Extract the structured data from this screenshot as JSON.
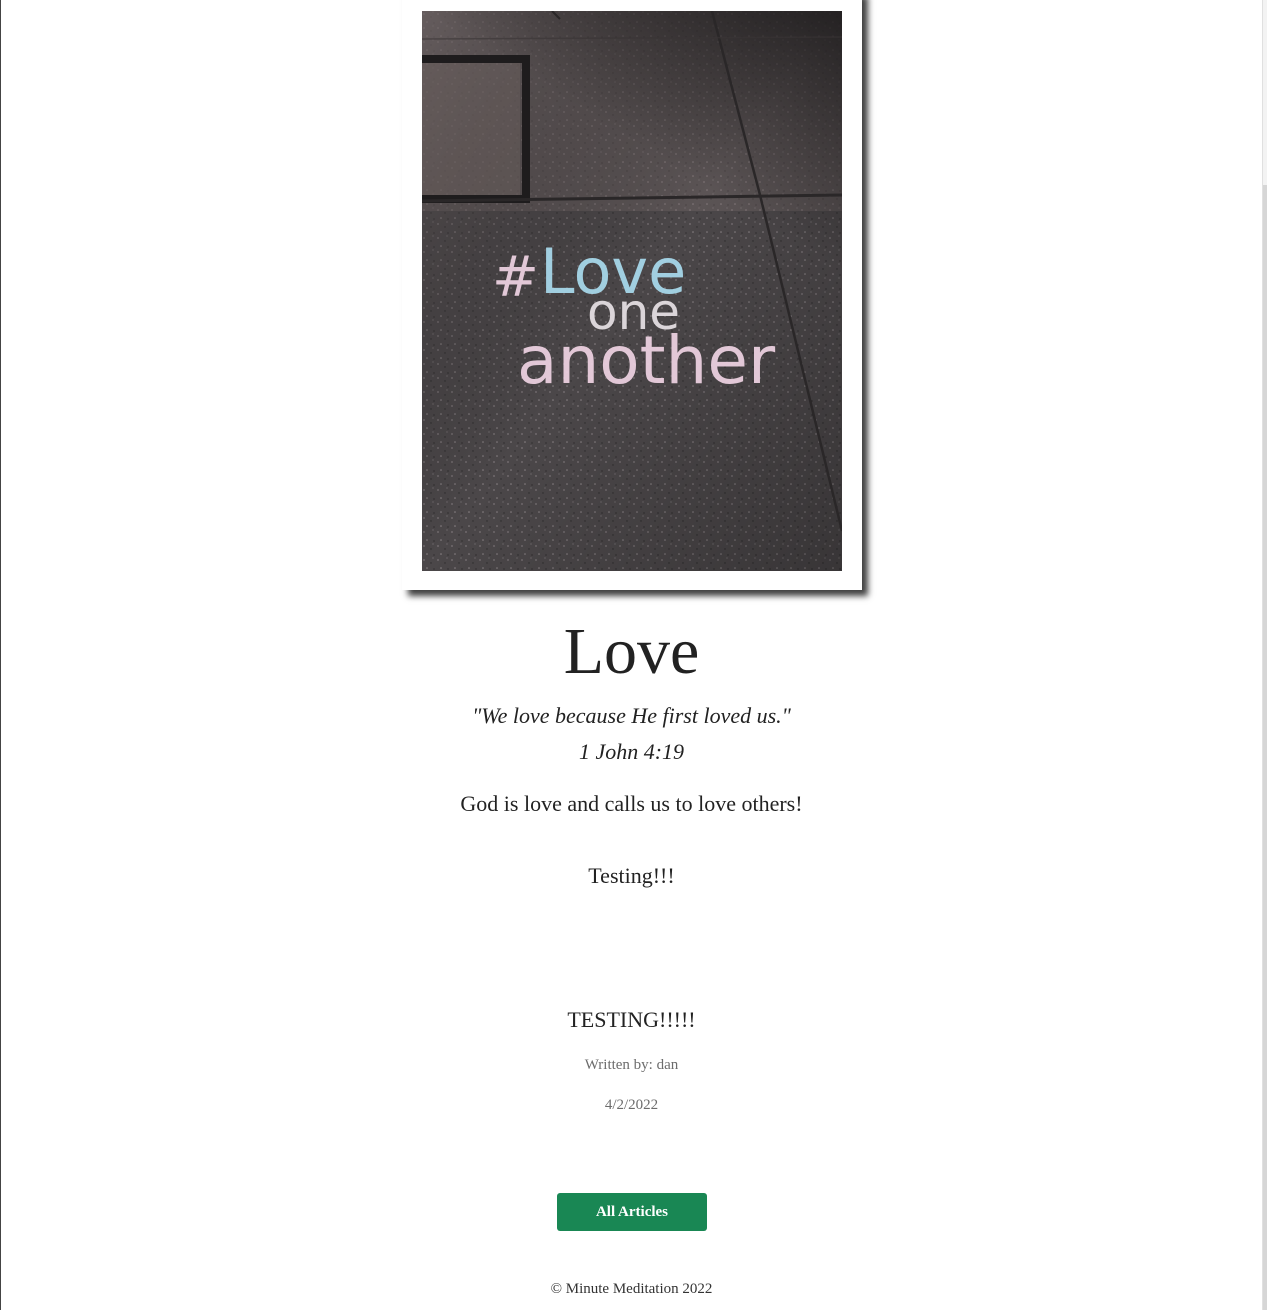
{
  "article": {
    "image_alt": "Chalk writing on a sidewalk",
    "chalk_text": {
      "line1_hash": "#",
      "line1_word": "Love",
      "line2": "one",
      "line3": "another"
    },
    "title": "Love",
    "verse_quote": "\"We love because He first loved us.\"",
    "verse_reference": "1 John 4:19",
    "body": [
      "God is love and calls us to love others!",
      "Testing!!!",
      "TESTING!!!!!"
    ],
    "author_line": "Written by: dan",
    "date": "4/2/2022"
  },
  "actions": {
    "all_articles_label": "All Articles"
  },
  "footer": {
    "copyright": "© Minute Meditation 2022"
  },
  "colors": {
    "button_green": "#198754",
    "chalk_blue": "#a9dbee",
    "chalk_pink": "#f0d4e4",
    "pavement": "#4a4648"
  }
}
